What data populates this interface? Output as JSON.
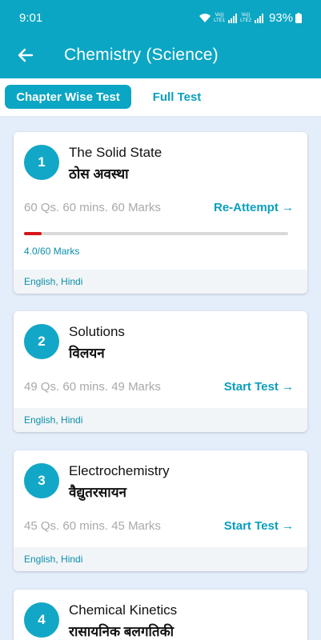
{
  "status_bar": {
    "time": "9:01",
    "battery": "93%",
    "sim1_label": "Vo)) LTE1",
    "sim2_label": "Vo)) LTE2"
  },
  "header": {
    "title": "Chemistry (Science)",
    "back_icon": "arrow-left-icon",
    "color": "#0aa6c4"
  },
  "tabs": [
    {
      "label": "Chapter Wise Test",
      "active": true
    },
    {
      "label": "Full Test",
      "active": false
    }
  ],
  "chapters": [
    {
      "number": "1",
      "name_en": "The Solid State",
      "name_hi": "ठोस अवस्था",
      "meta": "60 Qs. 60 mins. 60 Marks",
      "action": "Re-Attempt →",
      "progress": 0.0667,
      "score": "4.0/60 Marks",
      "languages": "English, Hindi"
    },
    {
      "number": "2",
      "name_en": "Solutions",
      "name_hi": "विलयन",
      "meta": "49 Qs. 60 mins. 49 Marks",
      "action": "Start Test →",
      "languages": "English, Hindi"
    },
    {
      "number": "3",
      "name_en": "Electrochemistry",
      "name_hi": "वैद्युतरसायन",
      "meta": "45 Qs. 60 mins. 45 Marks",
      "action": "Start Test →",
      "languages": "English, Hindi"
    },
    {
      "number": "4",
      "name_en": "Chemical Kinetics",
      "name_hi": "रासायनिक बलगतिकी"
    }
  ],
  "colors": {
    "accent": "#0aa6c4",
    "progress": "#d6151b",
    "background": "#e4edfa"
  }
}
